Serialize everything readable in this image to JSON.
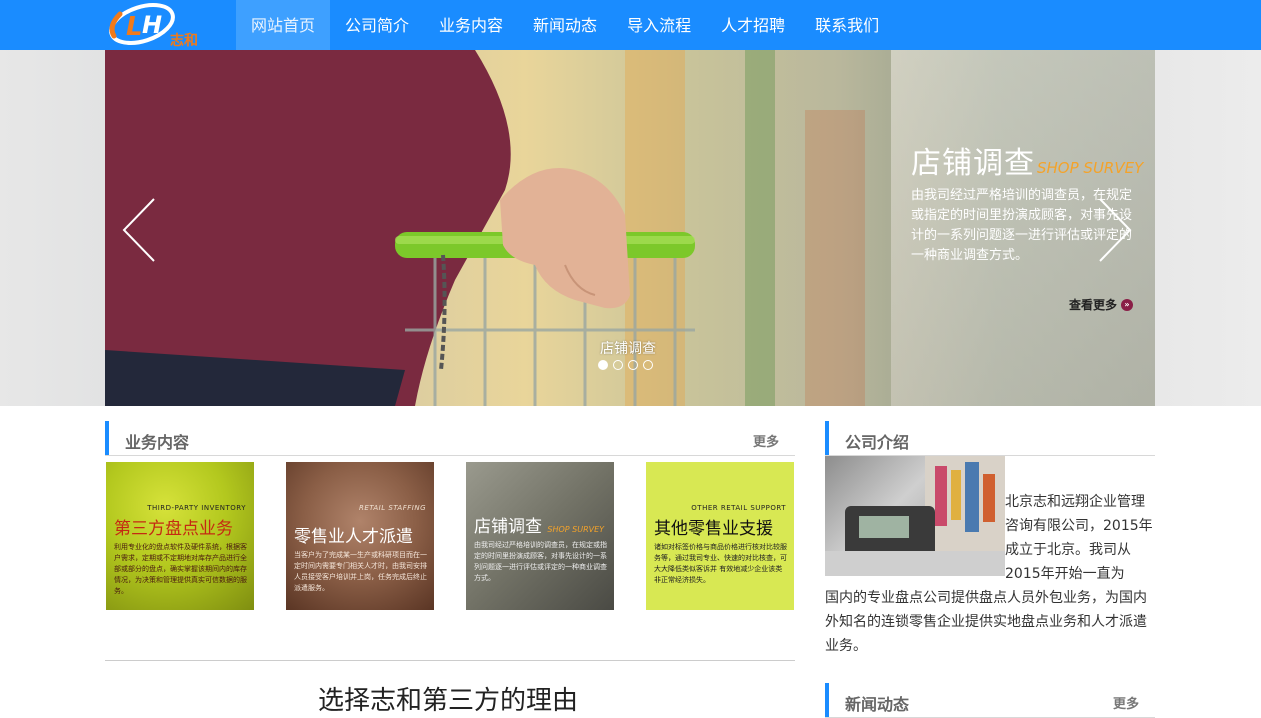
{
  "nav": {
    "logo_text": "志和",
    "items": [
      {
        "label": "网站首页",
        "active": true
      },
      {
        "label": "公司简介"
      },
      {
        "label": "业务内容"
      },
      {
        "label": "新闻动态"
      },
      {
        "label": "导入流程"
      },
      {
        "label": "人才招聘"
      },
      {
        "label": "联系我们"
      }
    ],
    "colors": {
      "bar": "#1a8cff",
      "active": "#3ea0ff"
    }
  },
  "banner": {
    "caption_title": "店铺调查",
    "caption_subtitle": "SHOP SURVEY",
    "caption_desc": "由我司经过严格培训的调查员，在规定或指定的时间里扮演成顾客，对事先设计的一系列问题逐一进行评估或评定的一种商业调查方式。",
    "more_label": "查看更多",
    "slide_label": "店铺调查",
    "slide_count": 4,
    "active_slide": 1
  },
  "services": {
    "title": "业务内容",
    "more": "更多",
    "tiles": [
      {
        "en": "THIRD-PARTY INVENTORY",
        "cn": "第三方盘点业务",
        "desc": "利用专业化的盘点软件及硬件系统，根据客户需求，定期或不定期地对库存产品进行全部或部分的盘点，确实掌握该期间内的库存情况，为决策和管理提供真实可信数据的服务。"
      },
      {
        "en": "RETAIL STAFFING",
        "cn": "零售业人才派遣",
        "desc": "当客户为了完成某一生产或科研项目而在一定时间内需要专门相关人才时，由我司安排人员接受客户培训并上岗，任务完成后终止派遣服务。"
      },
      {
        "en": "SHOP SURVEY",
        "cn": "店铺调查",
        "desc": "由我司经过严格培训的调查员，在规定或指定的时间里扮演成顾客，对事先设计的一系列问题逐一进行评估或评定的一种商业调查方式。"
      },
      {
        "en": "OTHER RETAIL SUPPORT",
        "cn": "其他零售业支援",
        "desc": "诸如对标签价格与商品价格进行核对比较服务等，通过我司专业、快速的对比核查，可大大降低类似客诉并 有效地减少企业该类非正常经济损失。"
      }
    ]
  },
  "why": {
    "title": "选择志和第三方的理由"
  },
  "intro": {
    "title": "公司介绍",
    "text_indent": "北京志和远翔企业管理咨询有限公司，2015年成立于北京。我司从2015年开始一直为",
    "text_rest": "国内的专业盘点公司提供盘点人员外包业务，为国内外知名的连锁零售企业提供实地盘点业务和人才派遣业务。"
  },
  "news": {
    "title": "新闻动态",
    "more": "更多"
  }
}
